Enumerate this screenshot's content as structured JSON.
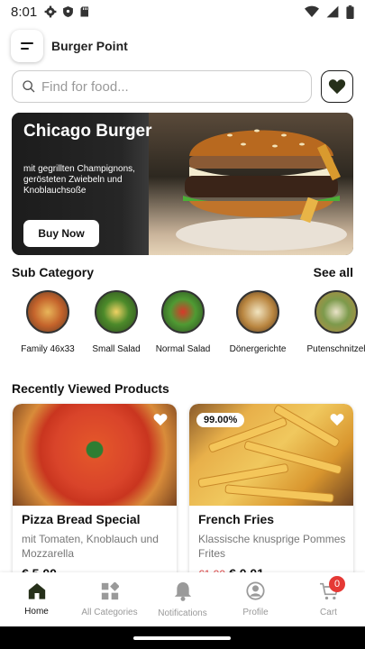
{
  "status_bar": {
    "time": "8:01"
  },
  "header": {
    "title": "Burger Point"
  },
  "search": {
    "placeholder": "Find for food..."
  },
  "banner": {
    "title": "Chicago Burger",
    "description": "mit gegrillten Champignons, gerösteten Zwiebeln und Knoblauchsoße",
    "button_label": "Buy Now"
  },
  "sub_category": {
    "title": "Sub Category",
    "see_all": "See all",
    "items": [
      {
        "label": "Family 46x33"
      },
      {
        "label": "Small Salad"
      },
      {
        "label": "Normal Salad"
      },
      {
        "label": "Dönergerichte"
      },
      {
        "label": "Putenschnitzel"
      }
    ]
  },
  "recently_viewed": {
    "title": "Recently Viewed Products",
    "products": [
      {
        "name": "Pizza Bread Special",
        "description": "mit Tomaten, Knoblauch und Mozzarella",
        "price": "€ 5.00"
      },
      {
        "name": "French Fries",
        "description": "Klassische knusprige Pommes Frites",
        "badge": "99.00%",
        "old_price": "€1.00",
        "price": "€ 0.01"
      }
    ]
  },
  "bottom_nav": {
    "items": [
      {
        "label": "Home",
        "icon": "home-icon"
      },
      {
        "label": "All Categories",
        "icon": "categories-icon"
      },
      {
        "label": "Notifications",
        "icon": "bell-icon"
      },
      {
        "label": "Profile",
        "icon": "profile-icon"
      },
      {
        "label": "Cart",
        "icon": "cart-icon"
      }
    ],
    "cart_count": "0"
  },
  "colors": {
    "primary_dark": "#26301a",
    "badge_red": "#e53935",
    "old_price_red": "#e04a4a",
    "muted_text": "#999999"
  }
}
